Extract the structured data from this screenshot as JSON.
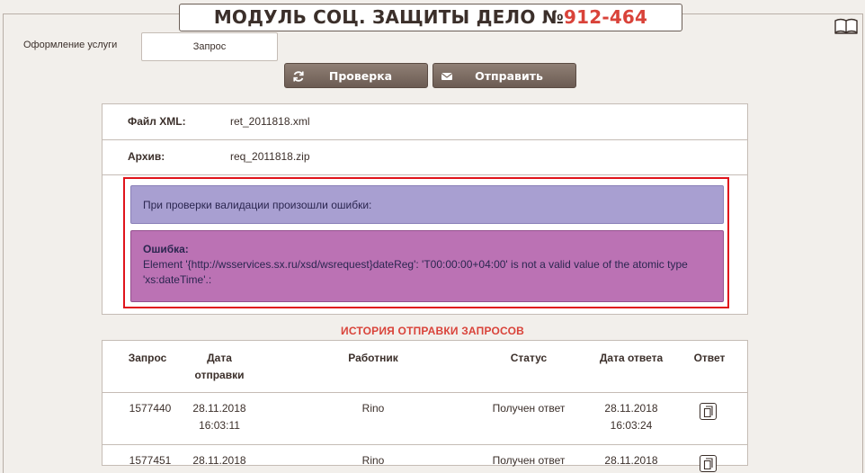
{
  "header": {
    "title_prefix": "МОДУЛЬ СОЦ. ЗАЩИТЫ ДЕЛО №",
    "case_number": "912-464"
  },
  "service": {
    "label": "Оформление услуги",
    "value": "Запрос"
  },
  "toolbar": {
    "check_label": "Проверка",
    "send_label": "Отправить"
  },
  "files": {
    "xml_label": "Файл XML:",
    "xml_value": "ret_2011818.xml",
    "archive_label": "Архив:",
    "archive_value": "req_2011818.zip"
  },
  "validation": {
    "summary": "При проверки валидации произошли ошибки:",
    "error_title": "Ошибка:",
    "error_text": "Element '{http://wsservices.sx.ru/xsd/wsrequest}dateReg': 'T00:00:00+04:00' is not a valid value of the atomic type 'xs:dateTime'.:"
  },
  "history": {
    "title": "ИСТОРИЯ ОТПРАВКИ ЗАПРОСОВ",
    "columns": {
      "request": "Запрос",
      "sent_1": "Дата",
      "sent_2": "отправки",
      "worker": "Работник",
      "status": "Статус",
      "answer_date": "Дата ответа",
      "answer": "Ответ"
    },
    "rows": [
      {
        "request": "1577440",
        "sent_date": "28.11.2018",
        "sent_time": "16:03:11",
        "worker": "Rino",
        "status": "Получен ответ",
        "answer_date": "28.11.2018",
        "answer_time": "16:03:24"
      },
      {
        "request": "1577451",
        "sent_date": "28.11.2018",
        "sent_time": "",
        "worker": "Rino",
        "status": "Получен ответ",
        "answer_date": "28.11.2018",
        "answer_time": ""
      }
    ]
  },
  "colors": {
    "accent": "#d9433a",
    "button": "#7d6d63",
    "error_border": "#e0141b",
    "info_bg": "#a89fd1",
    "error_bg": "#bb72b4"
  },
  "icons": [
    "book-icon",
    "refresh-icon",
    "envelope-icon",
    "document-icon"
  ]
}
